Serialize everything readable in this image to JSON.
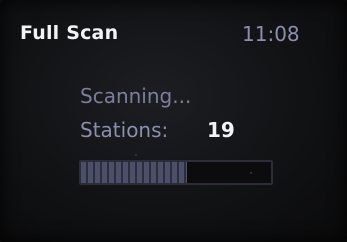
{
  "header": {
    "title": "Full Scan",
    "clock": "11:08"
  },
  "scan": {
    "status": "Scanning...",
    "stations_label": "Stations:",
    "stations_count": "19",
    "progress_fraction": 0.56
  },
  "colors": {
    "title_text": "#f2f3f5",
    "dim_text": "#8b8fae",
    "background": "#111214",
    "progress_fill": "#4b4f69",
    "progress_border": "#2b2d38"
  }
}
